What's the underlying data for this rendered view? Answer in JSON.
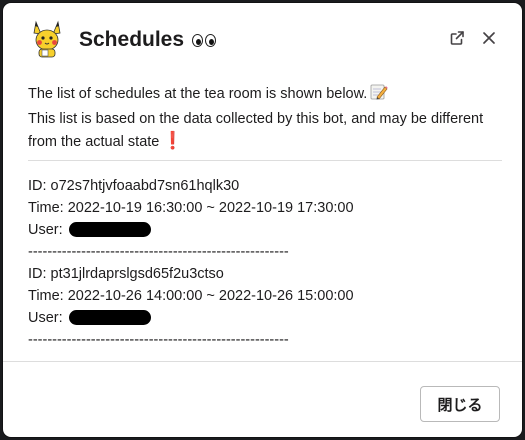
{
  "modal": {
    "title": "Schedules",
    "title_emoji": "eyes",
    "avatar_icon": "pikachu-avatar-icon",
    "popout_icon": "external-link-icon",
    "close_icon": "close-icon"
  },
  "intro": {
    "line1": "The list of schedules at the tea room is shown below.",
    "line1_emoji": "memo",
    "line2": "This list is based on the data collected by this bot, and may be different from the actual state",
    "line2_emoji": "exclamation",
    "exclamation_glyph": "❗"
  },
  "schedules": [
    {
      "id_line": "ID: o72s7htjvfoaabd7sn61hqlk30",
      "time_line": "Time: 2022-10-19 16:30:00 ~ 2022-10-19 17:30:00",
      "user_label": "User:",
      "separator": "------------------------------------------------------"
    },
    {
      "id_line": "ID: pt31jlrdaprslgsd65f2u3ctso",
      "time_line": "Time: 2022-10-26 14:00:00 ~ 2022-10-26 15:00:00",
      "user_label": "User:",
      "separator": "------------------------------------------------------"
    }
  ],
  "footer": {
    "close_label": "閉じる"
  },
  "colors": {
    "backdrop": "#1a1b1e",
    "text": "#1d1c1d",
    "exclamation": "#dd2e44",
    "divider": "#dddddd"
  }
}
